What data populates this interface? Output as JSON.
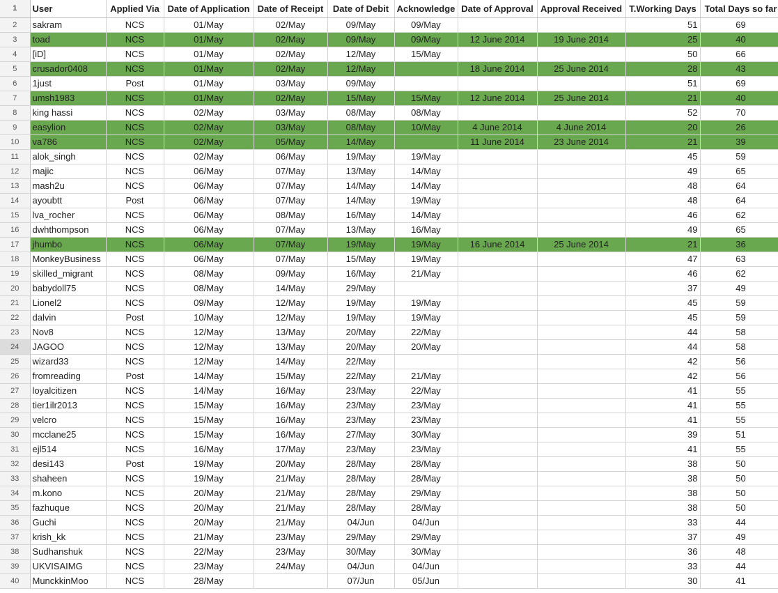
{
  "sheet": {
    "highlight_color": "#6aa84f",
    "active_row": 24,
    "columns": [
      "User",
      "Applied Via",
      "Date of Application",
      "Date of Receipt",
      "Date of Debit",
      "Acknowledge",
      "Date of Approval",
      "Approval Received",
      "T.Working Days",
      "Total Days so far"
    ],
    "rows": [
      {
        "n": 2,
        "hl": false,
        "cells": [
          "sakram",
          "NCS",
          "01/May",
          "02/May",
          "09/May",
          "09/May",
          "",
          "",
          "51",
          "69"
        ]
      },
      {
        "n": 3,
        "hl": true,
        "cells": [
          "toad",
          "NCS",
          "01/May",
          "02/May",
          "09/May",
          "09/May",
          "12 June 2014",
          "19 June 2014",
          "25",
          "40"
        ]
      },
      {
        "n": 4,
        "hl": false,
        "cells": [
          "[iD]",
          "NCS",
          "01/May",
          "02/May",
          "12/May",
          "15/May",
          "",
          "",
          "50",
          "66"
        ]
      },
      {
        "n": 5,
        "hl": true,
        "cells": [
          "crusador0408",
          "NCS",
          "01/May",
          "02/May",
          "12/May",
          "",
          "18 June 2014",
          "25 June 2014",
          "28",
          "43"
        ]
      },
      {
        "n": 6,
        "hl": false,
        "cells": [
          "1just",
          "Post",
          "01/May",
          "03/May",
          "09/May",
          "",
          "",
          "",
          "51",
          "69"
        ]
      },
      {
        "n": 7,
        "hl": true,
        "cells": [
          "umsh1983",
          "NCS",
          "01/May",
          "02/May",
          "15/May",
          "15/May",
          "12 June 2014",
          "25 June 2014",
          "21",
          "40"
        ]
      },
      {
        "n": 8,
        "hl": false,
        "cells": [
          "king hassi",
          "NCS",
          "02/May",
          "03/May",
          "08/May",
          "08/May",
          "",
          "",
          "52",
          "70"
        ]
      },
      {
        "n": 9,
        "hl": true,
        "cells": [
          "easylion",
          "NCS",
          "02/May",
          "03/May",
          "08/May",
          "10/May",
          "4 June 2014",
          "4 June 2014",
          "20",
          "26"
        ]
      },
      {
        "n": 10,
        "hl": true,
        "cells": [
          "va786",
          "NCS",
          "02/May",
          "05/May",
          "14/May",
          "",
          "11 June 2014",
          "23 June 2014",
          "21",
          "39"
        ]
      },
      {
        "n": 11,
        "hl": false,
        "cells": [
          "alok_singh",
          "NCS",
          "02/May",
          "06/May",
          "19/May",
          "19/May",
          "",
          "",
          "45",
          "59"
        ]
      },
      {
        "n": 12,
        "hl": false,
        "cells": [
          "majic",
          "NCS",
          "06/May",
          "07/May",
          "13/May",
          "14/May",
          "",
          "",
          "49",
          "65"
        ]
      },
      {
        "n": 13,
        "hl": false,
        "cells": [
          "mash2u",
          "NCS",
          "06/May",
          "07/May",
          "14/May",
          "14/May",
          "",
          "",
          "48",
          "64"
        ]
      },
      {
        "n": 14,
        "hl": false,
        "cells": [
          "ayoubtt",
          "Post",
          "06/May",
          "07/May",
          "14/May",
          "19/May",
          "",
          "",
          "48",
          "64"
        ]
      },
      {
        "n": 15,
        "hl": false,
        "cells": [
          "lva_rocher",
          "NCS",
          "06/May",
          "08/May",
          "16/May",
          "14/May",
          "",
          "",
          "46",
          "62"
        ]
      },
      {
        "n": 16,
        "hl": false,
        "cells": [
          "dwhthompson",
          "NCS",
          "06/May",
          "07/May",
          "13/May",
          "16/May",
          "",
          "",
          "49",
          "65"
        ]
      },
      {
        "n": 17,
        "hl": true,
        "cells": [
          "jhumbo",
          "NCS",
          "06/May",
          "07/May",
          "19/May",
          "19/May",
          "16 June 2014",
          "25 June 2014",
          "21",
          "36"
        ]
      },
      {
        "n": 18,
        "hl": false,
        "cells": [
          "MonkeyBusiness",
          "NCS",
          "06/May",
          "07/May",
          "15/May",
          "19/May",
          "",
          "",
          "47",
          "63"
        ]
      },
      {
        "n": 19,
        "hl": false,
        "cells": [
          "skilled_migrant",
          "NCS",
          "08/May",
          "09/May",
          "16/May",
          "21/May",
          "",
          "",
          "46",
          "62"
        ]
      },
      {
        "n": 20,
        "hl": false,
        "cells": [
          "babydoll75",
          "NCS",
          "08/May",
          "14/May",
          "29/May",
          "",
          "",
          "",
          "37",
          "49"
        ]
      },
      {
        "n": 21,
        "hl": false,
        "cells": [
          "Lionel2",
          "NCS",
          "09/May",
          "12/May",
          "19/May",
          "19/May",
          "",
          "",
          "45",
          "59"
        ]
      },
      {
        "n": 22,
        "hl": false,
        "cells": [
          "dalvin",
          "Post",
          "10/May",
          "12/May",
          "19/May",
          "19/May",
          "",
          "",
          "45",
          "59"
        ]
      },
      {
        "n": 23,
        "hl": false,
        "cells": [
          "Nov8",
          "NCS",
          "12/May",
          "13/May",
          "20/May",
          "22/May",
          "",
          "",
          "44",
          "58"
        ]
      },
      {
        "n": 24,
        "hl": false,
        "cells": [
          "JAGOO",
          "NCS",
          "12/May",
          "13/May",
          "20/May",
          "20/May",
          "",
          "",
          "44",
          "58"
        ]
      },
      {
        "n": 25,
        "hl": false,
        "cells": [
          "wizard33",
          "NCS",
          "12/May",
          "14/May",
          "22/May",
          "",
          "",
          "",
          "42",
          "56"
        ]
      },
      {
        "n": 26,
        "hl": false,
        "cells": [
          "fromreading",
          "Post",
          "14/May",
          "15/May",
          "22/May",
          "21/May",
          "",
          "",
          "42",
          "56"
        ]
      },
      {
        "n": 27,
        "hl": false,
        "cells": [
          "loyalcitizen",
          "NCS",
          "14/May",
          "16/May",
          "23/May",
          "22/May",
          "",
          "",
          "41",
          "55"
        ]
      },
      {
        "n": 28,
        "hl": false,
        "cells": [
          "tier1ilr2013",
          "NCS",
          "15/May",
          "16/May",
          "23/May",
          "23/May",
          "",
          "",
          "41",
          "55"
        ]
      },
      {
        "n": 29,
        "hl": false,
        "cells": [
          "velcro",
          "NCS",
          "15/May",
          "16/May",
          "23/May",
          "23/May",
          "",
          "",
          "41",
          "55"
        ]
      },
      {
        "n": 30,
        "hl": false,
        "cells": [
          "mcclane25",
          "NCS",
          "15/May",
          "16/May",
          "27/May",
          "30/May",
          "",
          "",
          "39",
          "51"
        ]
      },
      {
        "n": 31,
        "hl": false,
        "cells": [
          "ejl514",
          "NCS",
          "16/May",
          "17/May",
          "23/May",
          "23/May",
          "",
          "",
          "41",
          "55"
        ]
      },
      {
        "n": 32,
        "hl": false,
        "cells": [
          "desi143",
          "Post",
          "19/May",
          "20/May",
          "28/May",
          "28/May",
          "",
          "",
          "38",
          "50"
        ]
      },
      {
        "n": 33,
        "hl": false,
        "cells": [
          "shaheen",
          "NCS",
          "19/May",
          "21/May",
          "28/May",
          "28/May",
          "",
          "",
          "38",
          "50"
        ]
      },
      {
        "n": 34,
        "hl": false,
        "cells": [
          "m.kono",
          "NCS",
          "20/May",
          "21/May",
          "28/May",
          "29/May",
          "",
          "",
          "38",
          "50"
        ]
      },
      {
        "n": 35,
        "hl": false,
        "cells": [
          "fazhuque",
          "NCS",
          "20/May",
          "21/May",
          "28/May",
          "28/May",
          "",
          "",
          "38",
          "50"
        ]
      },
      {
        "n": 36,
        "hl": false,
        "cells": [
          "Guchi",
          "NCS",
          "20/May",
          "21/May",
          "04/Jun",
          "04/Jun",
          "",
          "",
          "33",
          "44"
        ]
      },
      {
        "n": 37,
        "hl": false,
        "cells": [
          "krish_kk",
          "NCS",
          "21/May",
          "23/May",
          "29/May",
          "29/May",
          "",
          "",
          "37",
          "49"
        ]
      },
      {
        "n": 38,
        "hl": false,
        "cells": [
          "Sudhanshuk",
          "NCS",
          "22/May",
          "23/May",
          "30/May",
          "30/May",
          "",
          "",
          "36",
          "48"
        ]
      },
      {
        "n": 39,
        "hl": false,
        "cells": [
          "UKVISAIMG",
          "NCS",
          "23/May",
          "24/May",
          "04/Jun",
          "04/Jun",
          "",
          "",
          "33",
          "44"
        ]
      },
      {
        "n": 40,
        "hl": false,
        "cells": [
          "MunckkinMoo",
          "NCS",
          "28/May",
          "",
          "07/Jun",
          "05/Jun",
          "",
          "",
          "30",
          "41"
        ]
      }
    ]
  }
}
